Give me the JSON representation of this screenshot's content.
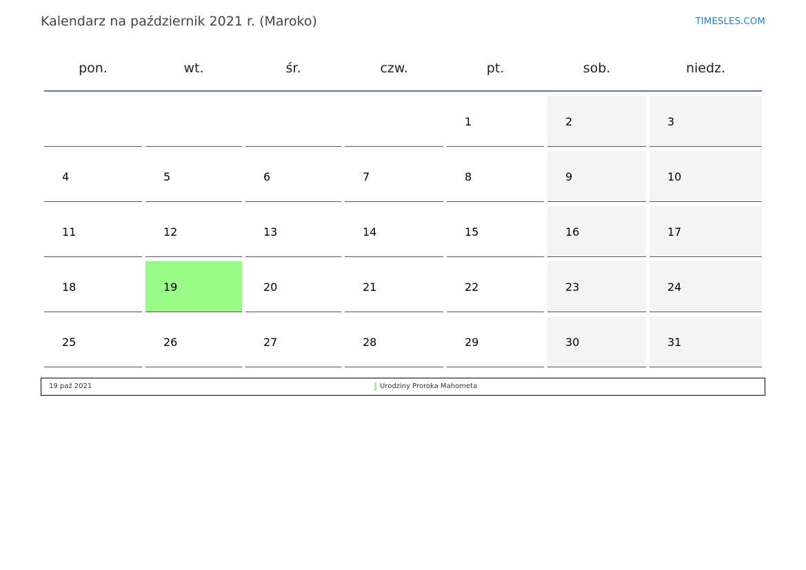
{
  "header": {
    "title": "Kalendarz na październik 2021 r. (Maroko)",
    "site": "TIMESLES.COM"
  },
  "weekdays": [
    "pon.",
    "wt.",
    "śr.",
    "czw.",
    "pt.",
    "sob.",
    "niedz."
  ],
  "weeks": [
    [
      "",
      "",
      "",
      "",
      "1",
      "2",
      "3"
    ],
    [
      "4",
      "5",
      "6",
      "7",
      "8",
      "9",
      "10"
    ],
    [
      "11",
      "12",
      "13",
      "14",
      "15",
      "16",
      "17"
    ],
    [
      "18",
      "19",
      "20",
      "21",
      "22",
      "23",
      "24"
    ],
    [
      "25",
      "26",
      "27",
      "28",
      "29",
      "30",
      "31"
    ]
  ],
  "holiday_day": "19",
  "colors": {
    "holiday": "#99fb88",
    "weekend": "#f4f4f4",
    "header_line": "#5c7896",
    "link": "#2a7ab8"
  },
  "legend": {
    "date": "19 paź 2021",
    "name": "Urodziny Proroka Mahometa"
  }
}
